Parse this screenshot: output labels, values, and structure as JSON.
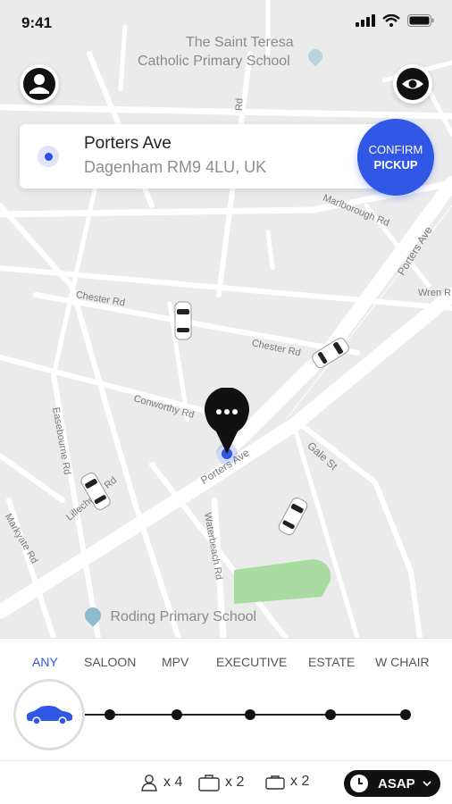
{
  "status_bar": {
    "time": "9:41"
  },
  "map": {
    "poi_top_line1": "The Saint Teresa",
    "poi_top_line2": "Catholic Primary School",
    "poi_bottom": "Roding Primary School",
    "streets": {
      "marlborough": "Marlborough Rd",
      "porters_ave_top": "Porters Ave",
      "wren": "Wren R",
      "chester_1": "Chester Rd",
      "chester_2": "Chester Rd",
      "conworthy": "Conworthy Rd",
      "porters_ave_mid": "Porters Ave",
      "gale": "Gale St",
      "lillechurch": "Lillechurch Rd",
      "easebourne": "Easebourne Rd",
      "markyate": "Markyate Rd",
      "waterbeach": "Waterbeach Rd",
      "top_rd": "Rd"
    }
  },
  "address": {
    "street": "Porters Ave",
    "city": "Dagenham RM9 4LU, UK"
  },
  "confirm": {
    "line1": "CONFIRM",
    "line2": "PICKUP"
  },
  "vehicle_tabs": [
    {
      "label": "ANY",
      "active": true
    },
    {
      "label": "SALOON",
      "active": false
    },
    {
      "label": "MPV",
      "active": false
    },
    {
      "label": "EXECUTIVE",
      "active": false
    },
    {
      "label": "ESTATE",
      "active": false
    },
    {
      "label": "W CHAIR",
      "active": false
    }
  ],
  "options": {
    "passengers": "x 4",
    "luggage": "x 2",
    "hand_luggage": "x 2",
    "time": "ASAP"
  },
  "colors": {
    "accent": "#3057e6",
    "park": "#a8dba0"
  }
}
